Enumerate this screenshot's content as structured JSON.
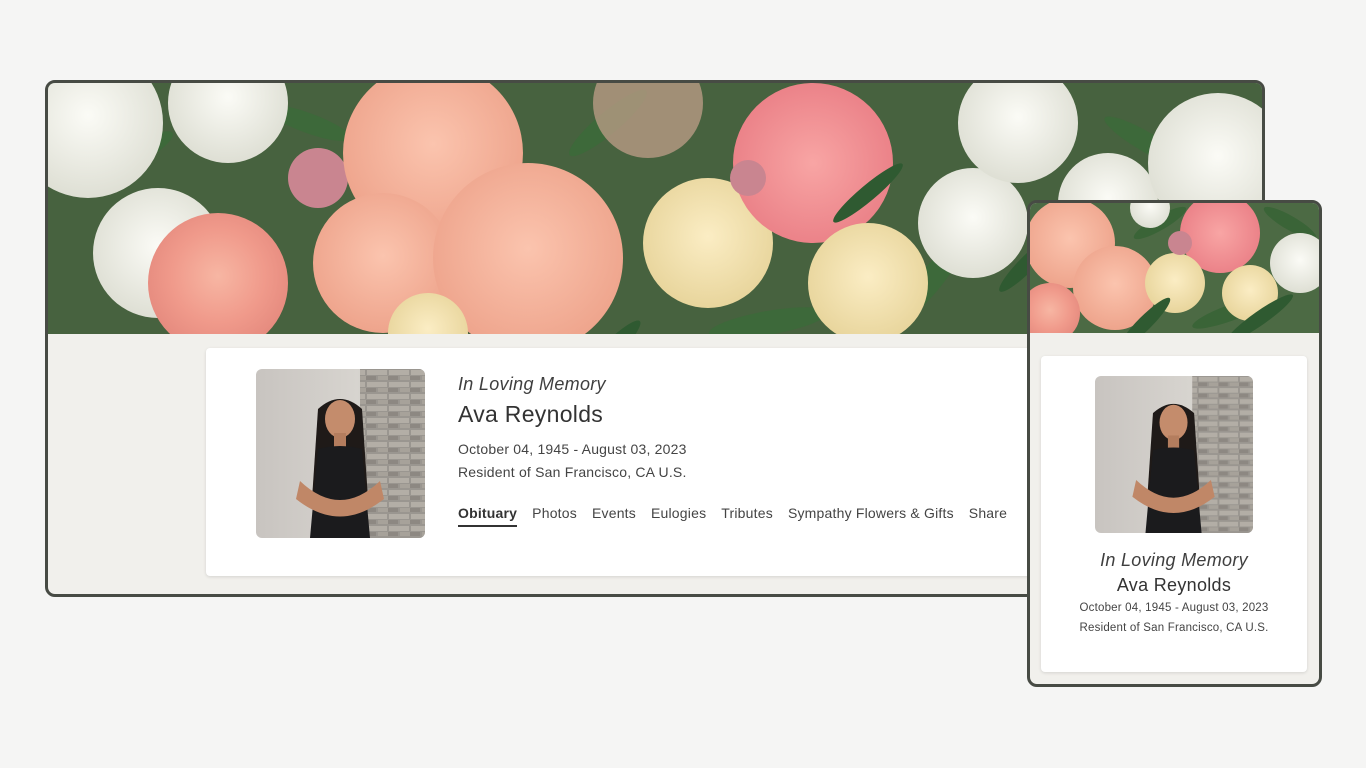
{
  "desktop": {
    "header_label": "In Loving Memory",
    "name": "Ava Reynolds",
    "dates": "October 04, 1945 - August 03, 2023",
    "resident": "Resident of San Francisco, CA U.S.",
    "tabs": [
      {
        "label": "Obituary",
        "active": true
      },
      {
        "label": "Photos"
      },
      {
        "label": "Events"
      },
      {
        "label": "Eulogies"
      },
      {
        "label": "Tributes"
      },
      {
        "label": "Sympathy Flowers & Gifts"
      },
      {
        "label": "Share"
      }
    ]
  },
  "mobile": {
    "header_label": "In Loving Memory",
    "name": "Ava Reynolds",
    "dates": "October 04, 1945 - August 03, 2023",
    "resident": "Resident of San Francisco, CA U.S."
  },
  "colors": {
    "frame": "#474b44",
    "page_bg": "#f5f5f4",
    "card_bg": "#ffffff",
    "frame_bg": "#f1f0ec"
  }
}
